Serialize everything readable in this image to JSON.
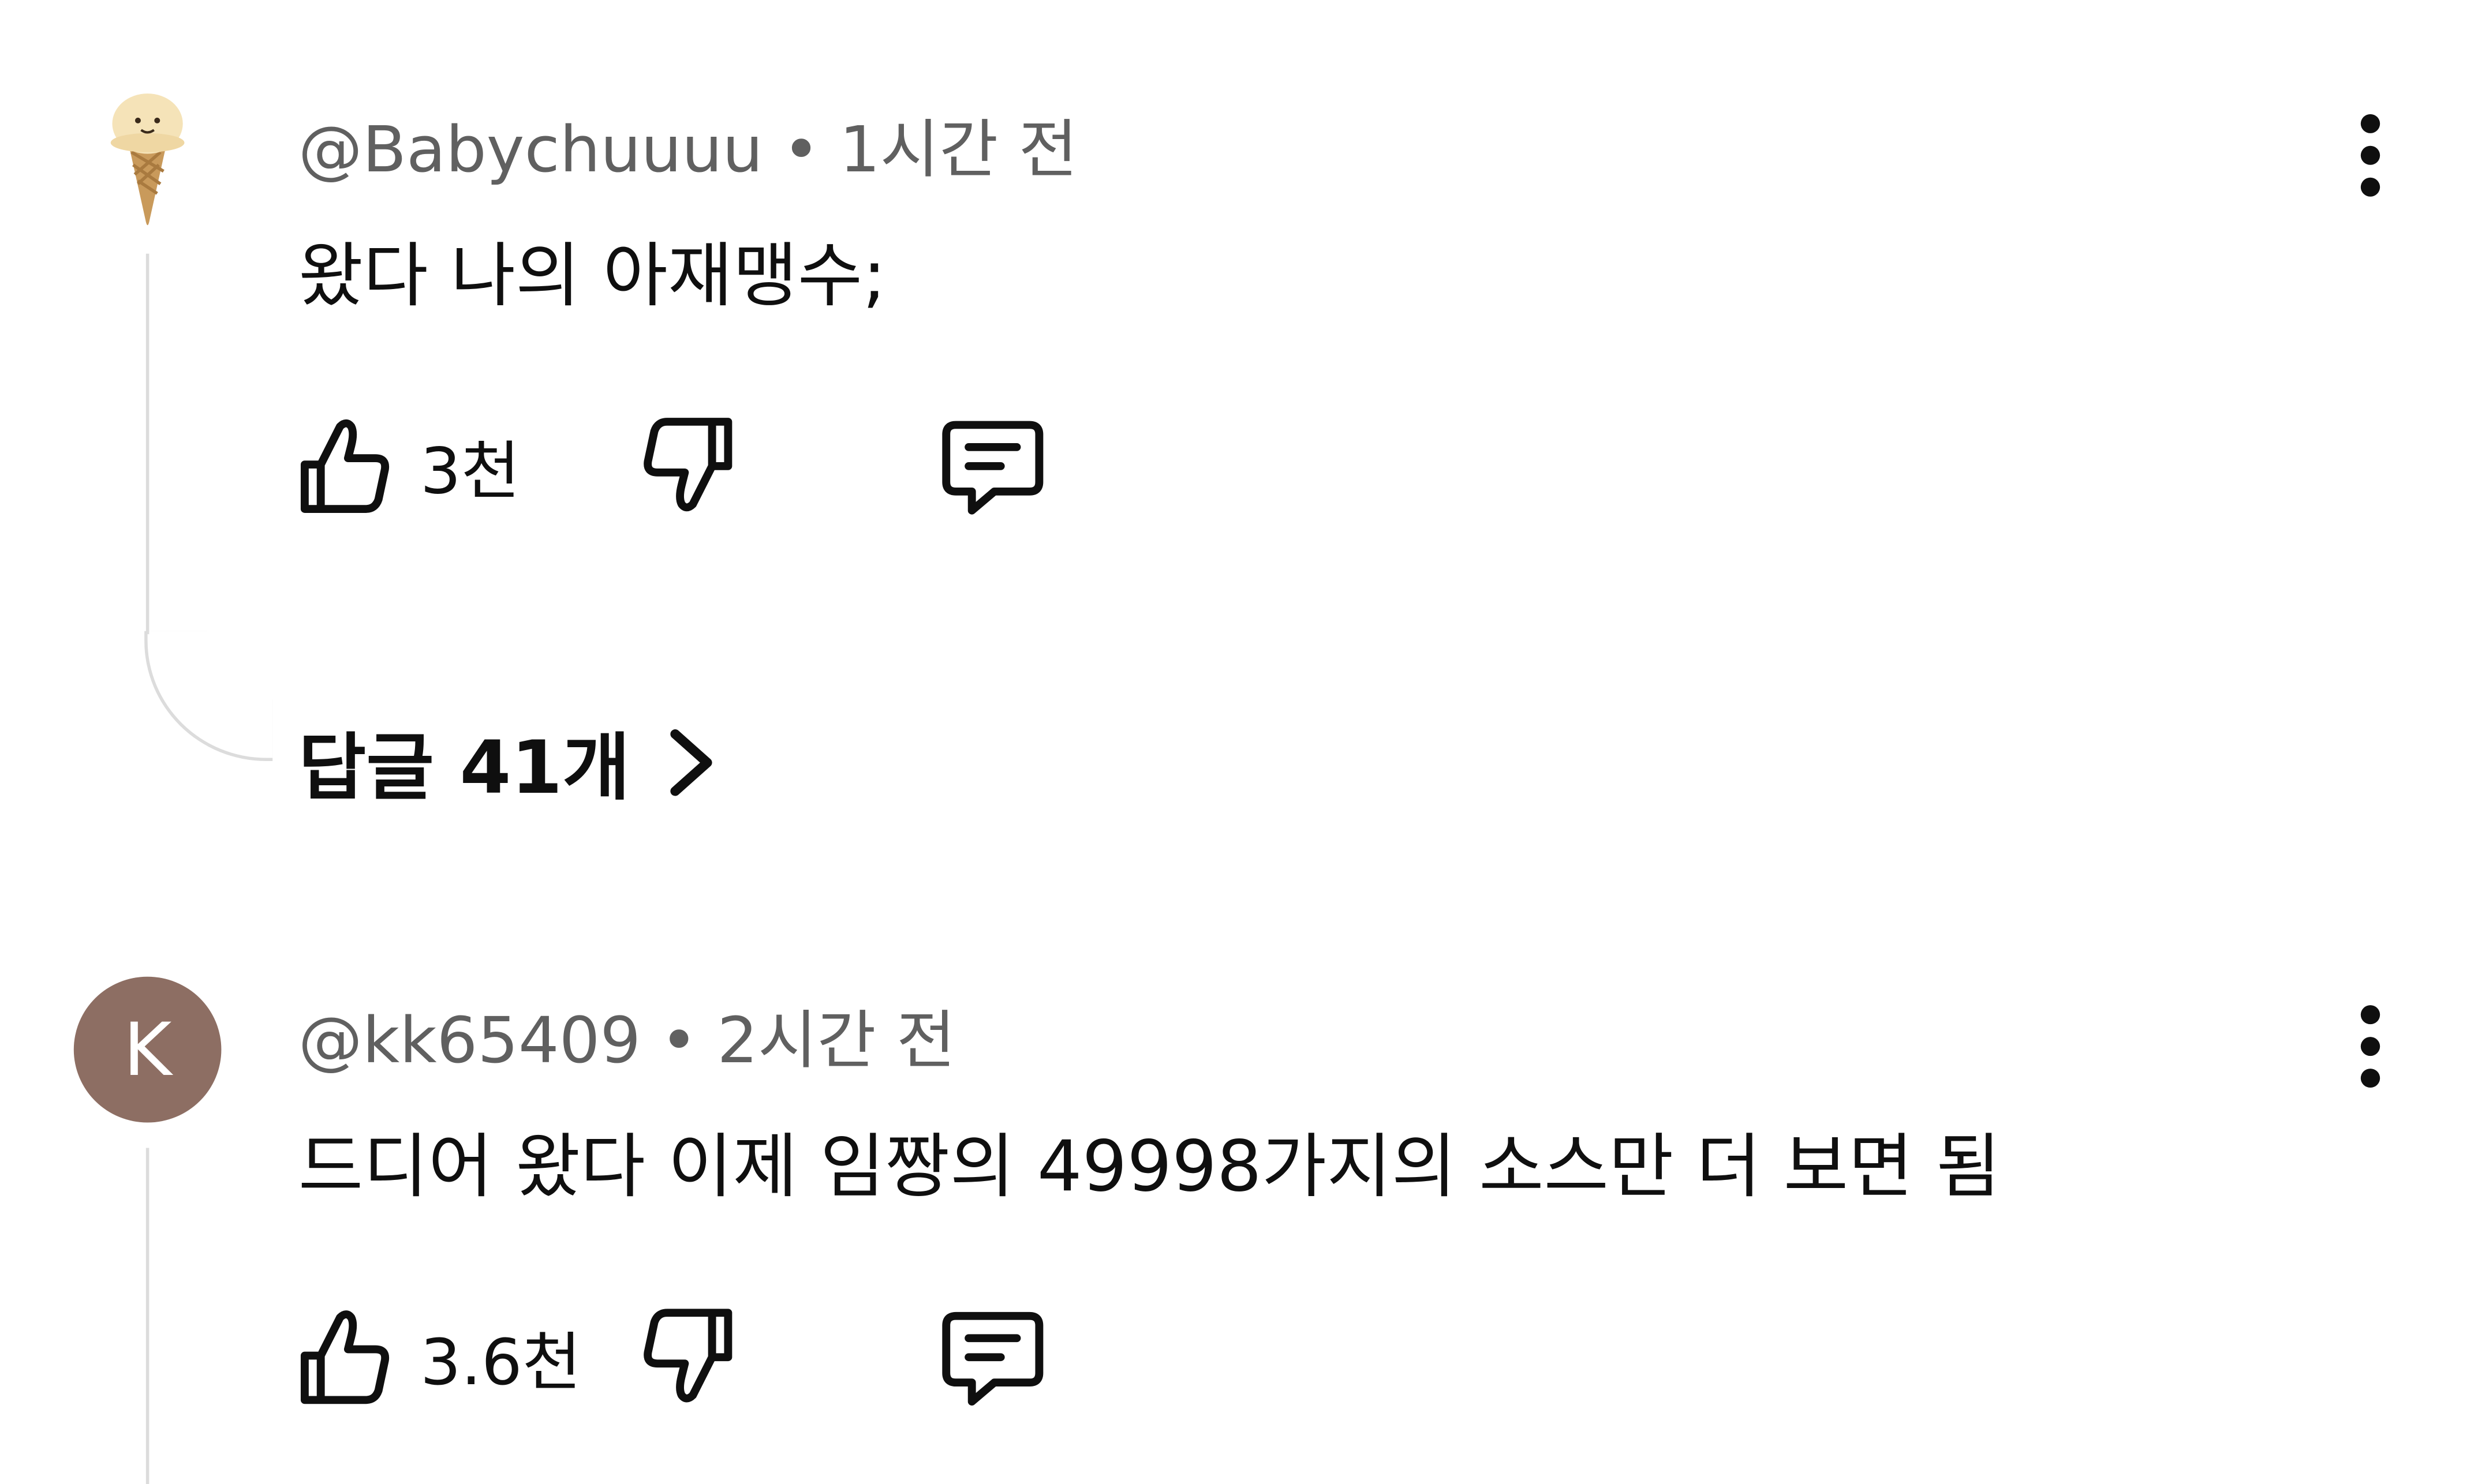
{
  "comments": [
    {
      "handle": "@Babychuuuu",
      "separator": "•",
      "time": "1시간 전",
      "text": "왔다 나의 아재맹수;",
      "likes": "3천",
      "avatar": "ice-cream-cone-photo",
      "replies_label": "답글 41개"
    },
    {
      "handle": "@kk65409",
      "separator": "•",
      "time": "2시간 전",
      "text": "드디어 왔다 이제 임짱의 49998가지의 소스만 더 보면 됨",
      "likes": "3.6천",
      "avatar_letter": "K",
      "avatar_color": "#8d6e63"
    }
  ],
  "icons": {
    "like": "thumb-up-icon",
    "dislike": "thumb-down-icon",
    "reply": "comment-icon",
    "more": "more-vertical-icon",
    "expand": "chevron-right-icon"
  }
}
